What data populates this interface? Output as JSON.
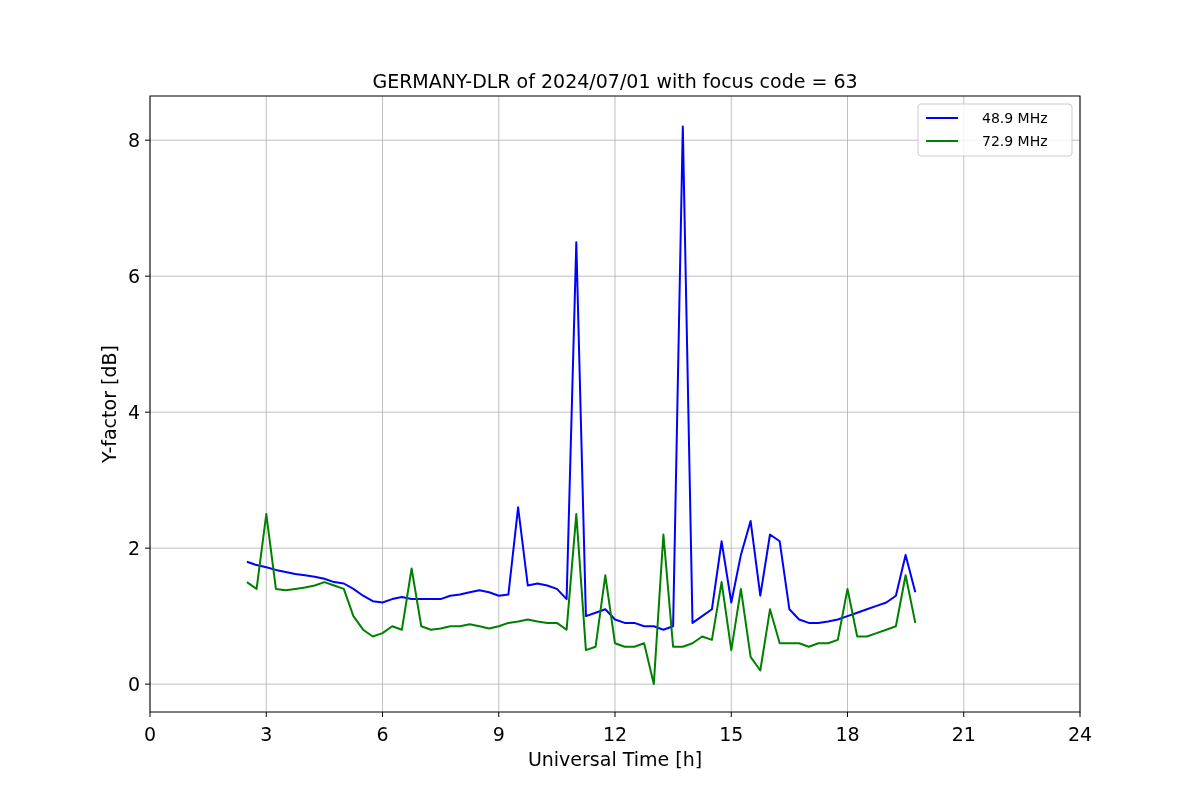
{
  "figure": {
    "chart_data": {
      "type": "line",
      "title": "GERMANY-DLR of 2024/07/01 with focus code = 63",
      "xlabel": "Universal Time [h]",
      "ylabel": "Y-factor [dB]",
      "x": [
        2.5,
        2.75,
        3,
        3.25,
        3.5,
        3.75,
        4,
        4.25,
        4.5,
        4.75,
        5,
        5.25,
        5.5,
        5.75,
        6,
        6.25,
        6.5,
        6.75,
        7,
        7.25,
        7.5,
        7.75,
        8,
        8.25,
        8.5,
        8.75,
        9,
        9.25,
        9.5,
        9.75,
        10,
        10.25,
        10.5,
        10.75,
        11,
        11.25,
        11.5,
        11.75,
        12,
        12.25,
        12.5,
        12.75,
        13,
        13.25,
        13.5,
        13.75,
        14,
        14.25,
        14.5,
        14.75,
        15,
        15.25,
        15.5,
        15.75,
        16,
        16.25,
        16.5,
        16.75,
        17,
        17.25,
        17.5,
        17.75,
        18,
        18.25,
        18.5,
        18.75,
        19,
        19.25,
        19.5,
        19.75
      ],
      "series": [
        {
          "name": "48.9 MHz",
          "color": "#0000ff",
          "values": [
            1.8,
            1.75,
            1.72,
            1.68,
            1.65,
            1.62,
            1.6,
            1.58,
            1.55,
            1.5,
            1.48,
            1.4,
            1.3,
            1.22,
            1.2,
            1.25,
            1.28,
            1.25,
            1.25,
            1.25,
            1.25,
            1.3,
            1.32,
            1.35,
            1.38,
            1.35,
            1.3,
            1.32,
            2.6,
            1.45,
            1.48,
            1.45,
            1.4,
            1.25,
            6.5,
            1.0,
            1.05,
            1.1,
            0.95,
            0.9,
            0.9,
            0.85,
            0.85,
            0.8,
            0.85,
            8.2,
            0.9,
            1.0,
            1.1,
            2.1,
            1.2,
            1.9,
            2.4,
            1.3,
            2.2,
            2.1,
            1.1,
            0.95,
            0.9,
            0.9,
            0.92,
            0.95,
            1.0,
            1.05,
            1.1,
            1.15,
            1.2,
            1.3,
            1.9,
            1.35
          ]
        },
        {
          "name": "72.9 MHz",
          "color": "#008000",
          "values": [
            1.5,
            1.4,
            2.5,
            1.4,
            1.38,
            1.4,
            1.42,
            1.45,
            1.5,
            1.45,
            1.4,
            1.0,
            0.8,
            0.7,
            0.75,
            0.85,
            0.8,
            1.7,
            0.85,
            0.8,
            0.82,
            0.85,
            0.85,
            0.88,
            0.85,
            0.82,
            0.85,
            0.9,
            0.92,
            0.95,
            0.92,
            0.9,
            0.9,
            0.8,
            2.5,
            0.5,
            0.55,
            1.6,
            0.6,
            0.55,
            0.55,
            0.6,
            0.0,
            2.2,
            0.55,
            0.55,
            0.6,
            0.7,
            0.65,
            1.5,
            0.5,
            1.4,
            0.4,
            0.2,
            1.1,
            0.6,
            0.6,
            0.6,
            0.55,
            0.6,
            0.6,
            0.65,
            1.4,
            0.7,
            0.7,
            0.75,
            0.8,
            0.85,
            1.6,
            0.9
          ]
        }
      ],
      "xlim": [
        0,
        24
      ],
      "ylim": [
        -0.41,
        8.65
      ],
      "xticks": [
        0,
        3,
        6,
        9,
        12,
        15,
        18,
        21,
        24
      ],
      "yticks": [
        0,
        2,
        4,
        6,
        8
      ],
      "grid": true,
      "legend": true
    }
  }
}
